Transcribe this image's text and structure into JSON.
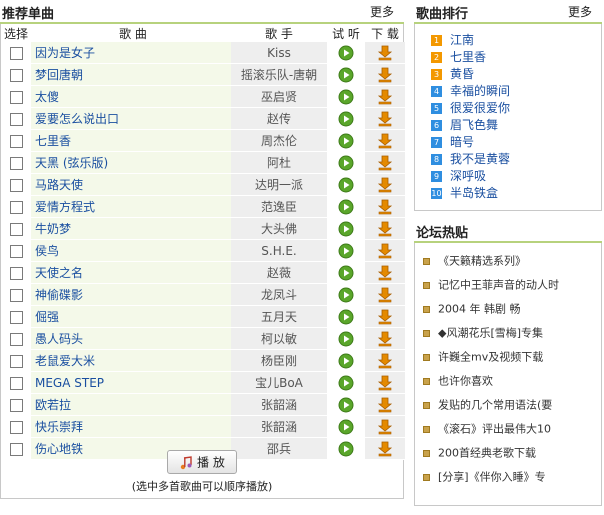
{
  "left": {
    "title": "推荐单曲",
    "more": "更多",
    "headers": {
      "select": "选择",
      "song": "歌 曲",
      "singer": "歌 手",
      "try": "试 听",
      "download": "下 载"
    },
    "songs": [
      {
        "name": "因为是女子",
        "singer": "Kiss"
      },
      {
        "name": "梦回唐朝",
        "singer": "摇滚乐队-唐朝"
      },
      {
        "name": "太傻",
        "singer": "巫启贤"
      },
      {
        "name": "爱要怎么说出口",
        "singer": "赵传"
      },
      {
        "name": "七里香",
        "singer": "周杰伦"
      },
      {
        "name": "天黑 (弦乐版)",
        "singer": "阿杜"
      },
      {
        "name": "马路天使",
        "singer": "达明一派"
      },
      {
        "name": "爱情方程式",
        "singer": "范逸臣"
      },
      {
        "name": "牛奶梦",
        "singer": "大头佛"
      },
      {
        "name": "侯鸟",
        "singer": "S.H.E."
      },
      {
        "name": "天使之名",
        "singer": "赵薇"
      },
      {
        "name": "神偷碟影",
        "singer": "龙凤斗"
      },
      {
        "name": "倔强",
        "singer": "五月天"
      },
      {
        "name": "愚人码头",
        "singer": "柯以敏"
      },
      {
        "name": "老鼠爱大米",
        "singer": "杨臣刚"
      },
      {
        "name": "MEGA STEP",
        "singer": "宝儿BoA"
      },
      {
        "name": "欧若拉",
        "singer": "张韶涵"
      },
      {
        "name": "快乐崇拜",
        "singer": "张韶涵"
      },
      {
        "name": "伤心地铁",
        "singer": "邵兵"
      }
    ],
    "play_button": "播 放",
    "play_note": "(选中多首歌曲可以顺序播放)"
  },
  "rank": {
    "title": "歌曲排行",
    "more": "更多",
    "items": [
      {
        "num": "1",
        "name": "江南",
        "color": "#f39800"
      },
      {
        "num": "2",
        "name": "七里香",
        "color": "#f39800"
      },
      {
        "num": "3",
        "name": "黄昏",
        "color": "#f39800"
      },
      {
        "num": "4",
        "name": "幸福的瞬间",
        "color": "#2f8ee0"
      },
      {
        "num": "5",
        "name": "很爱很爱你",
        "color": "#2f8ee0"
      },
      {
        "num": "6",
        "name": "眉飞色舞",
        "color": "#2f8ee0"
      },
      {
        "num": "7",
        "name": "暗号",
        "color": "#2f8ee0"
      },
      {
        "num": "8",
        "name": "我不是黄蓉",
        "color": "#2f8ee0"
      },
      {
        "num": "9",
        "name": "深呼吸",
        "color": "#2f8ee0"
      },
      {
        "num": "10",
        "name": "半岛铁盒",
        "color": "#2f8ee0"
      }
    ]
  },
  "forum": {
    "title": "论坛热贴",
    "items": [
      "《天籁精选系列》",
      "记忆中王菲声音的动人时",
      "2004 年 韩剧 畅",
      "◆风潮花乐[雪梅]专集",
      "许巍全mv及视频下载",
      "也许你喜欢",
      "发贴的几个常用语法(要",
      "《滚石》评出最伟大10",
      "200首经典老歌下载",
      "[分享]《伴你入睡》专"
    ]
  },
  "colors": {
    "accent_line": "#b7d27d",
    "link": "#1a4fa0",
    "play_green": "#5aa62a",
    "download_orange": "#e48a00"
  },
  "icons": {
    "play": "play-circle-icon",
    "download": "download-arrow-icon",
    "music_note": "music-note-icon"
  }
}
